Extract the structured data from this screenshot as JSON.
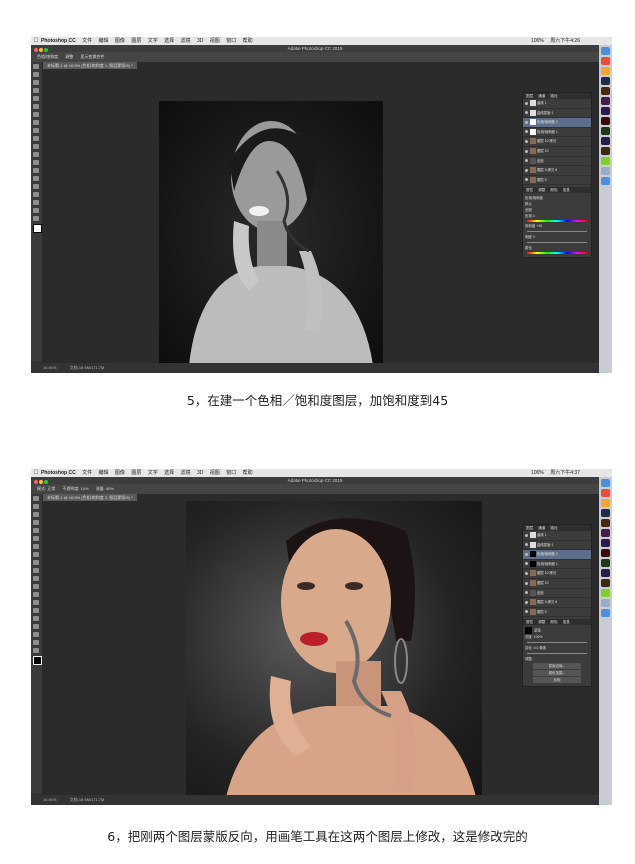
{
  "screen1": {
    "menu": {
      "app": "Photoshop CC",
      "items": [
        "文件",
        "编辑",
        "图像",
        "图层",
        "文字",
        "选择",
        "滤镜",
        "3D",
        "视图",
        "窗口",
        "帮助"
      ],
      "right": "周六下午4:26",
      "battery": "100%"
    },
    "window_title": "Adobe Photoshop CC 2015",
    "options": [
      "色相/饱和度",
      "调整",
      "显示变换控件"
    ],
    "doc_tab": "未标题-1 @ 16.5% (色相/饱和度 1, 图层蒙版/8) *",
    "status": [
      "16.91%",
      "文档:18.5M/171.7M"
    ],
    "layers_tabs": [
      "图层",
      "通道",
      "路径"
    ],
    "layers": [
      {
        "name": "曲线 1",
        "selected": false
      },
      {
        "name": "曲线蒙版 1",
        "selected": false
      },
      {
        "name": "色相/饱和度 2",
        "selected": true
      },
      {
        "name": "色相/饱和度 1",
        "selected": false
      },
      {
        "name": "图层 10 拷贝",
        "selected": false
      },
      {
        "name": "图层 10",
        "selected": false
      },
      {
        "name": "皮肤",
        "selected": false
      },
      {
        "name": "图层 5 拷贝 6",
        "selected": false
      },
      {
        "name": "图层 5",
        "selected": false
      }
    ],
    "properties_tabs": [
      "属性",
      "调整",
      "颜色",
      "信息"
    ],
    "properties": {
      "title": "色相/饱和度",
      "preset": "默认",
      "channel": "全图",
      "hue_label": "色相",
      "hue_value": "0",
      "sat_label": "饱和度",
      "sat_value": "+45",
      "light_label": "明度",
      "light_value": "0",
      "colorize": "着色"
    }
  },
  "caption1": "5，在建一个色相／饱和度图层，加饱和度到45",
  "screen2": {
    "menu": {
      "app": "Photoshop CC",
      "items": [
        "文件",
        "编辑",
        "图像",
        "图层",
        "文字",
        "选择",
        "滤镜",
        "3D",
        "视图",
        "窗口",
        "帮助"
      ],
      "right": "周六下午4:37",
      "battery": "100%"
    },
    "window_title": "Adobe Photoshop CC 2015",
    "options": [
      "模式: 正常",
      "不透明度: 10%",
      "流量: 40%"
    ],
    "doc_tab": "未标题-1 @ 16.5% (色相/饱和度 2, 图层蒙版/8) *",
    "status": [
      "16.91%",
      "文档:18.5M/171.7M"
    ],
    "layers_tabs": [
      "图层",
      "通道",
      "路径"
    ],
    "layers": [
      {
        "name": "曲线 1",
        "selected": false
      },
      {
        "name": "曲线蒙版 1",
        "selected": false
      },
      {
        "name": "色相/饱和度 2",
        "selected": true
      },
      {
        "name": "色相/饱和度 1",
        "selected": false
      },
      {
        "name": "图层 10 拷贝",
        "selected": false
      },
      {
        "name": "图层 10",
        "selected": false
      },
      {
        "name": "皮肤",
        "selected": false
      },
      {
        "name": "图层 5 拷贝 6",
        "selected": false
      },
      {
        "name": "图层 5",
        "selected": false
      }
    ],
    "properties_tabs": [
      "属性",
      "调整",
      "颜色",
      "信息"
    ],
    "properties": {
      "title": "蒙版",
      "density_label": "浓度:",
      "density_value": "100%",
      "feather_label": "羽化:",
      "feather_value": "0.0 像素",
      "adjust_label": "调整:",
      "btn1": "蒙版边缘...",
      "btn2": "颜色范围...",
      "btn3": "反相"
    }
  },
  "caption2": "6，把刚两个图层蒙版反向，用画笔工具在这两个图层上修改，这是修改完的",
  "colors": {
    "ps_bg": "#2b2b2b",
    "panel": "#3c3c3c",
    "selected": "#5b6f8a",
    "dock": "#c9ccd2"
  }
}
